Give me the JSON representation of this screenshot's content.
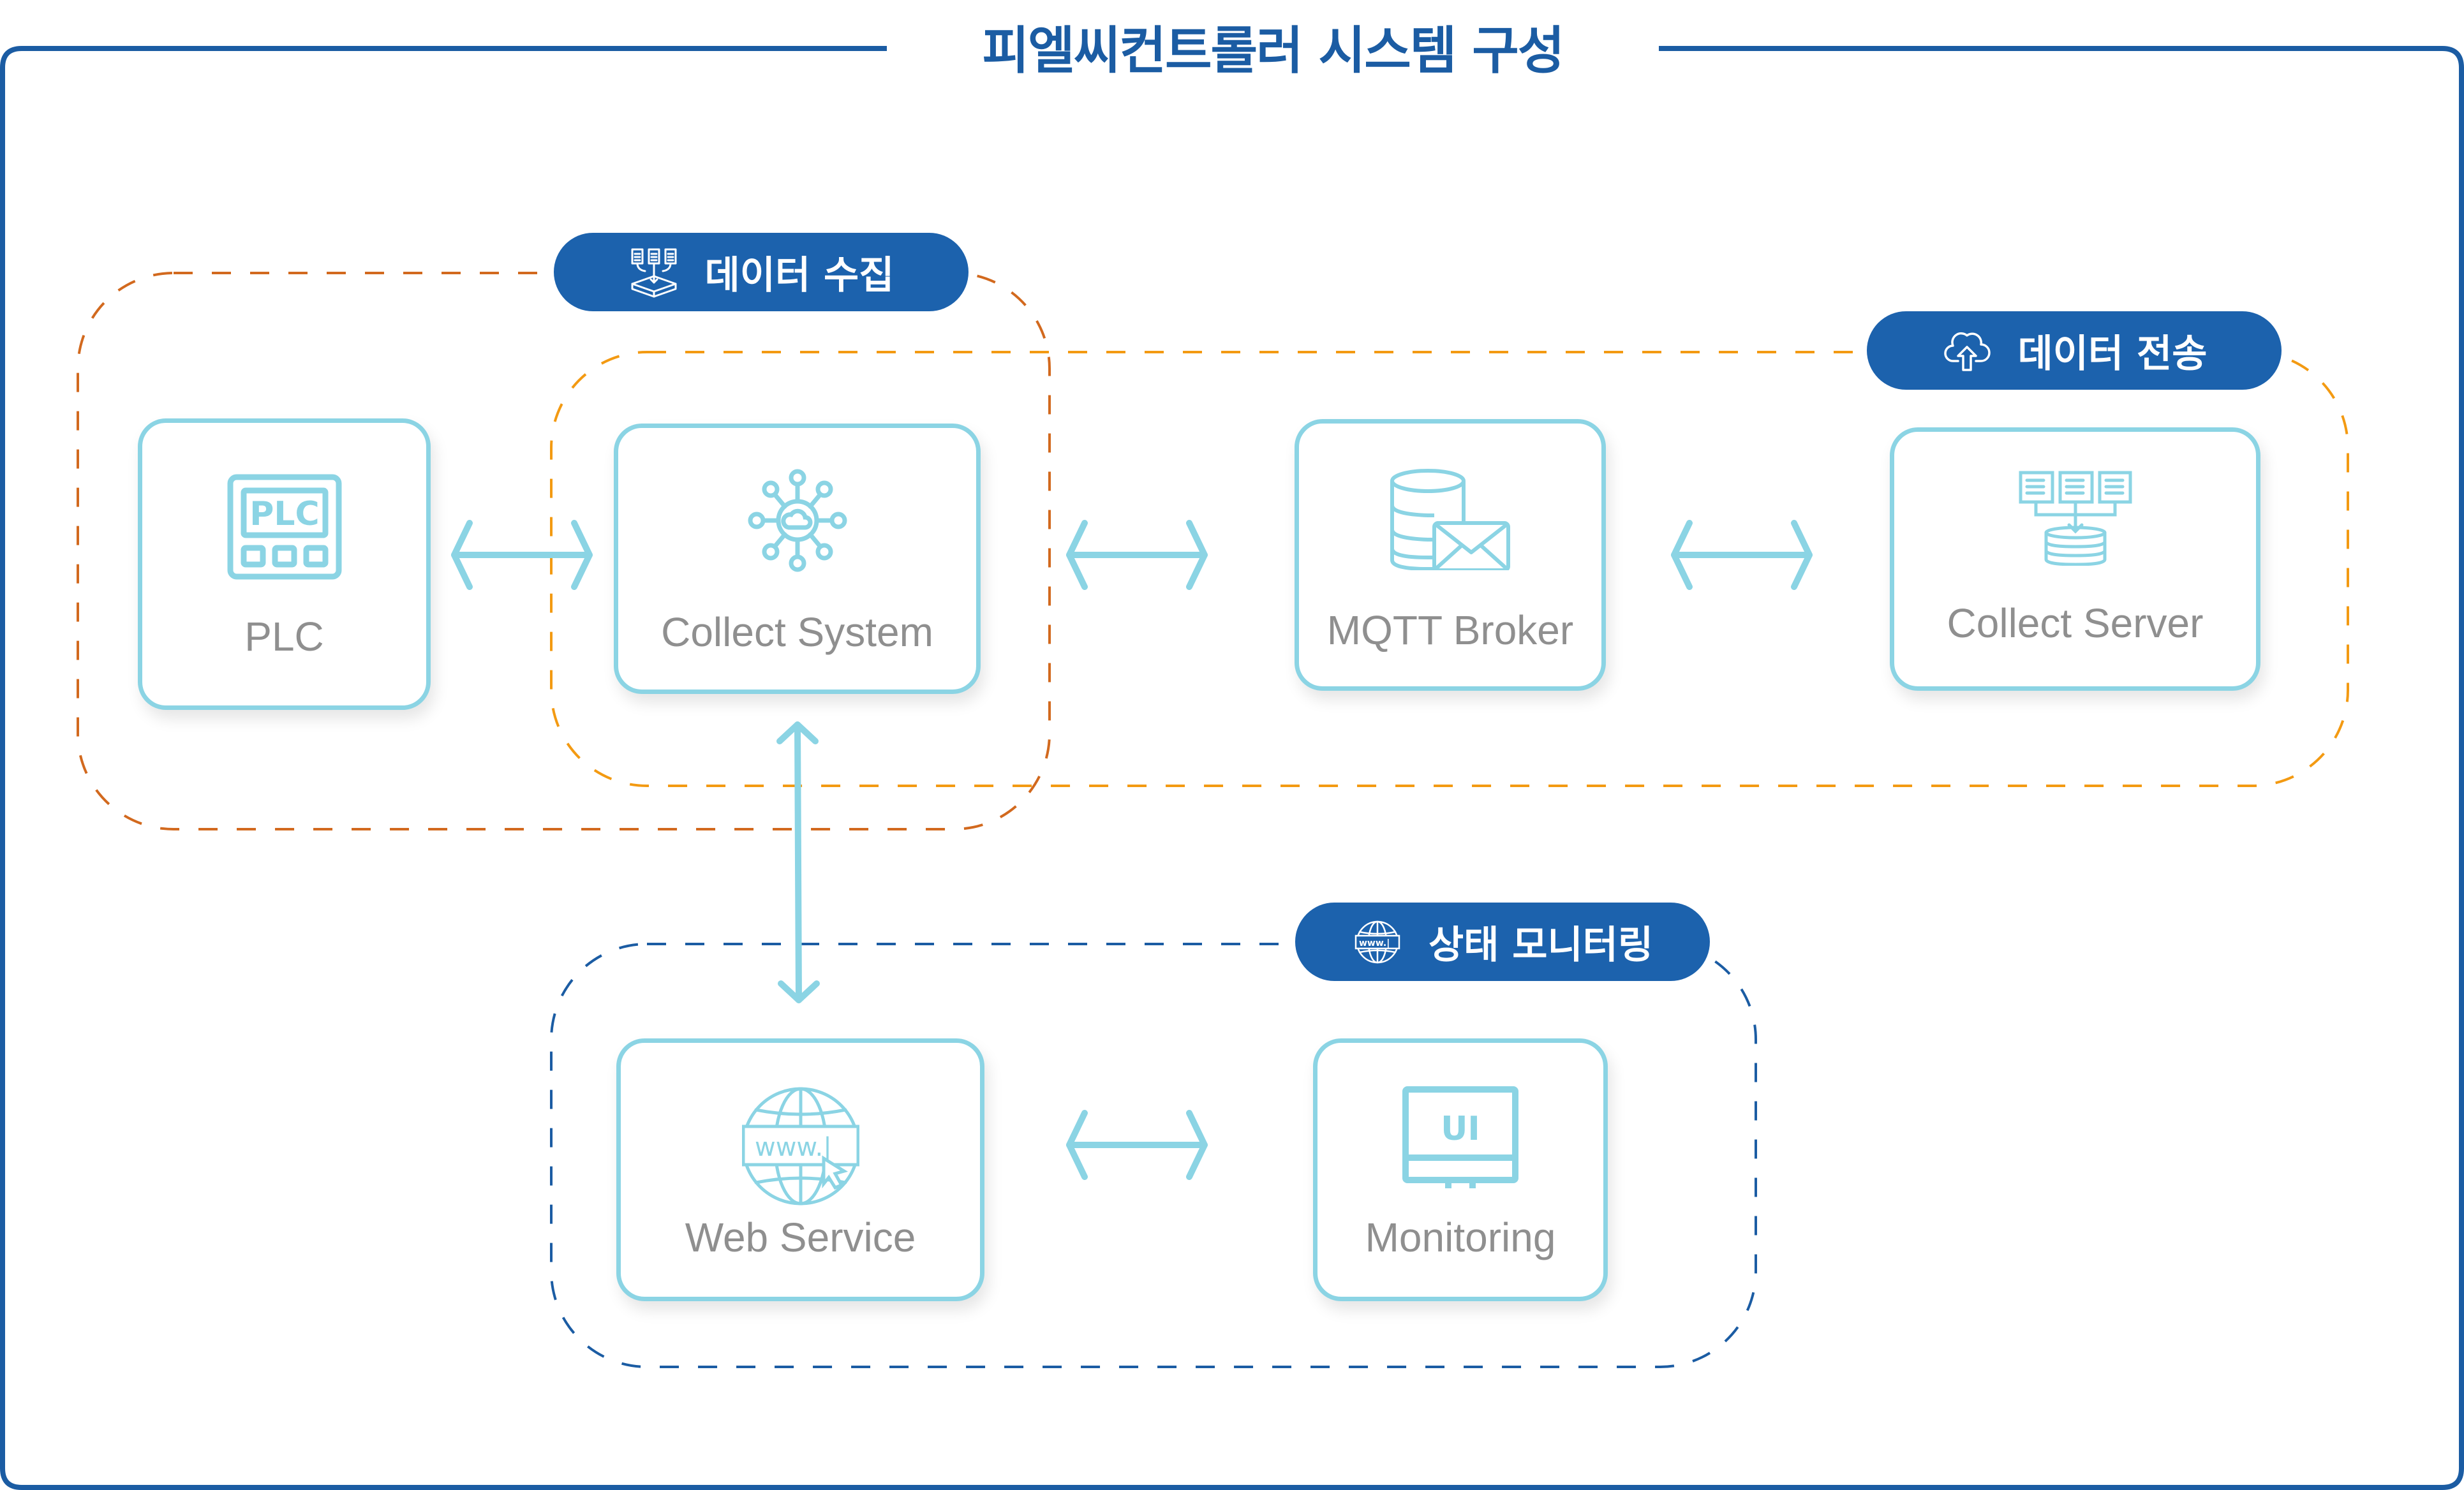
{
  "title": "피엘씨컨트롤러 시스템 구성",
  "colors": {
    "frame": "#1B5CA3",
    "pill": "#1C62AD",
    "collect_group": "#D2691E",
    "transfer_group": "#F39A12",
    "monitor_group": "#1B5CA3",
    "card_border": "#8BD4E4",
    "label": "#8F8F8F",
    "arrow": "#8BD4E4"
  },
  "groups": [
    {
      "id": "collect",
      "label": "데이터 수집",
      "icon": "data-collection-icon"
    },
    {
      "id": "transfer",
      "label": "데이터 전송",
      "icon": "cloud-upload-icon"
    },
    {
      "id": "monitor",
      "label": "상태 모니터링",
      "icon": "globe-www-icon"
    }
  ],
  "nodes": [
    {
      "id": "plc",
      "label": "PLC",
      "icon": "plc-icon",
      "group": "collect"
    },
    {
      "id": "collect_system",
      "label": "Collect System",
      "icon": "cloud-network-icon",
      "group": "collect,transfer"
    },
    {
      "id": "mqtt_broker",
      "label": "MQTT Broker",
      "icon": "database-mail-icon",
      "group": "transfer"
    },
    {
      "id": "collect_server",
      "label": "Collect Server",
      "icon": "documents-to-database-icon",
      "group": "transfer"
    },
    {
      "id": "web_service",
      "label": "Web Service",
      "icon": "globe-www-icon",
      "group": "monitor"
    },
    {
      "id": "monitoring",
      "label": "Monitoring",
      "icon": "monitor-ui-icon",
      "group": "monitor"
    }
  ],
  "connections": [
    {
      "from": "plc",
      "to": "collect_system",
      "type": "bidirectional"
    },
    {
      "from": "collect_system",
      "to": "mqtt_broker",
      "type": "bidirectional"
    },
    {
      "from": "mqtt_broker",
      "to": "collect_server",
      "type": "bidirectional"
    },
    {
      "from": "collect_system",
      "to": "web_service",
      "type": "bidirectional"
    },
    {
      "from": "web_service",
      "to": "monitoring",
      "type": "bidirectional"
    }
  ],
  "icon_text": {
    "plc": "PLC",
    "www": "www.|",
    "ui": "UI"
  }
}
